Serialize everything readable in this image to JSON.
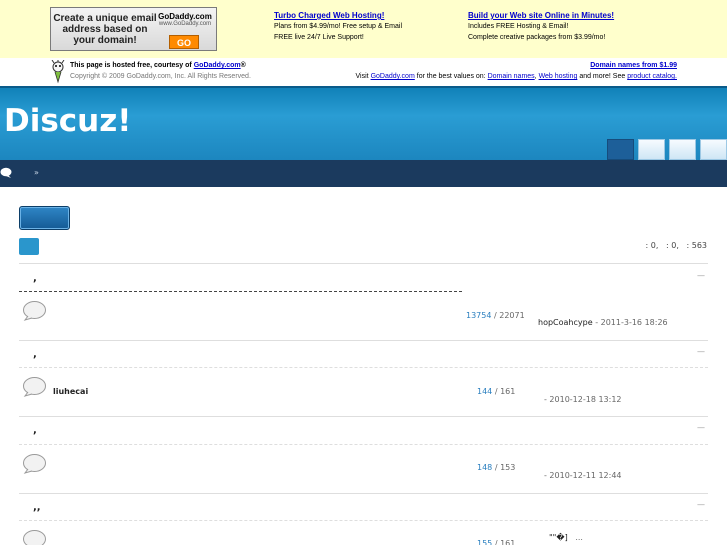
{
  "ad": {
    "banner_text": "Create a unique email address based on your domain!",
    "logo": "GoDaddy.com",
    "logo_sub": "www.GoDaddy.com",
    "go_label": "GO",
    "promo1": {
      "title": "Turbo Charged Web Hosting!",
      "line1": "Plans from $4.99/mo! Free setup & Email",
      "line2": "FREE live 24/7 Live Support!"
    },
    "promo2": {
      "title": "Build your Web site Online in Minutes!",
      "line1": "Includes FREE Hosting & Email!",
      "line2": "Complete creative packages from $3.99/mo!"
    }
  },
  "hosted": {
    "prefix": "This page is hosted free, courtesy of",
    "link": "GoDaddy.com",
    "suffix": "®",
    "copyright": "Copyright © 2009 GoDaddy.com, Inc. All Rights Reserved.",
    "domain_link": "Domain names from $1.99",
    "visit_prefix": "Visit",
    "visit_link": "GoDaddy.com",
    "visit_mid": "for the best values on:",
    "link_domains": "Domain names",
    "link_hosting": "Web hosting",
    "visit_and": "and more! See",
    "link_catalog": "product catalog."
  },
  "header": {
    "logo": "Discuz!",
    "nav_sep": "»"
  },
  "stats": ": 0,   : 0,   : 563",
  "groups": [
    {
      "title": ",",
      "collapse": "—",
      "forums": [
        {
          "moderator": "",
          "count_topics": "13754",
          "count_posts": "22071",
          "last_by": "hopCoahcype",
          "last_time": "- 2011-3-16 18:26"
        }
      ]
    },
    {
      "title": ",",
      "collapse": "—",
      "forums": [
        {
          "moderator": "liuhecai",
          "count_topics": "144",
          "count_posts": "161",
          "last_by": "",
          "last_time": "- 2010-12-18 13:12"
        }
      ]
    },
    {
      "title": ",",
      "collapse": "—",
      "forums": [
        {
          "moderator": "",
          "count_topics": "148",
          "count_posts": "153",
          "last_by": "",
          "last_time": "- 2010-12-11 12:44"
        }
      ]
    },
    {
      "title": ",,",
      "collapse": "—",
      "forums": [
        {
          "moderator": "",
          "count_topics": "155",
          "count_posts": "161",
          "last_by": "\"\"�]",
          "last_time": "..."
        }
      ]
    }
  ],
  "count_separator": " / "
}
